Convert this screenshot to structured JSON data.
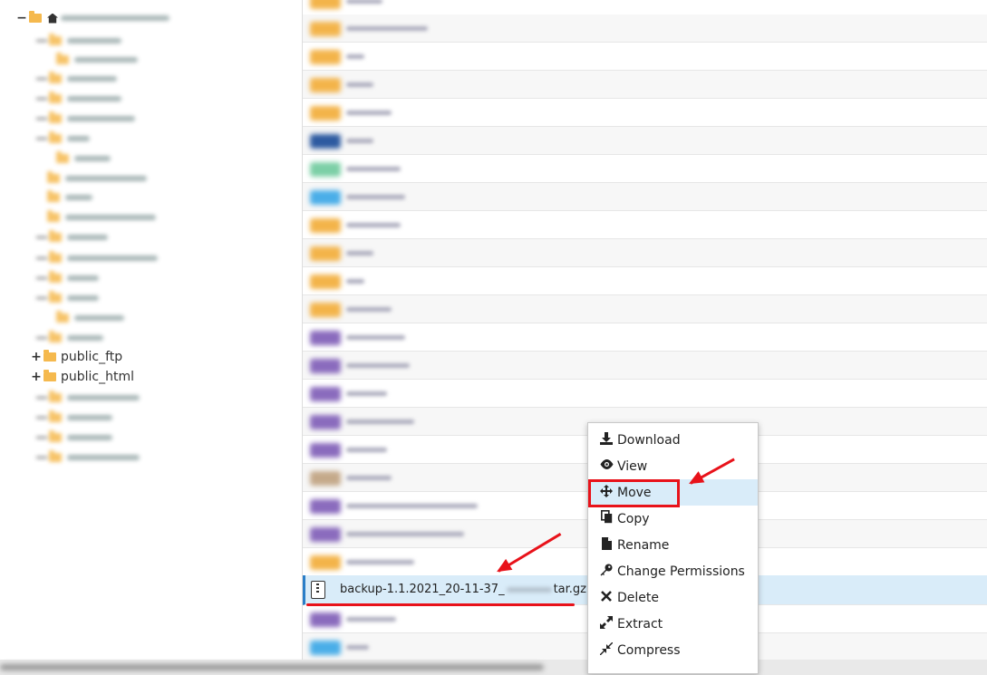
{
  "tree": {
    "expanded_nodes": [
      {
        "label": "public_ftp",
        "toggle": "+"
      },
      {
        "label": "public_html",
        "toggle": "+"
      }
    ]
  },
  "file_list": {
    "selected_file": {
      "name_prefix": "backup-1.1.2021_20-11-37_",
      "name_suffix": "tar.gz"
    }
  },
  "context_menu": {
    "items": [
      {
        "label": "Download",
        "icon": "download-icon"
      },
      {
        "label": "View",
        "icon": "eye-icon"
      },
      {
        "label": "Move",
        "icon": "move-icon"
      },
      {
        "label": "Copy",
        "icon": "copy-icon"
      },
      {
        "label": "Rename",
        "icon": "file-icon"
      },
      {
        "label": "Change Permissions",
        "icon": "key-icon"
      },
      {
        "label": "Delete",
        "icon": "times-icon"
      },
      {
        "label": "Extract",
        "icon": "expand-icon"
      },
      {
        "label": "Compress",
        "icon": "compress-icon"
      }
    ],
    "highlighted": "Move"
  },
  "colors": {
    "annotation": "#e8121a",
    "selection": "#d9ecf9",
    "folder": "#f5b94e"
  }
}
